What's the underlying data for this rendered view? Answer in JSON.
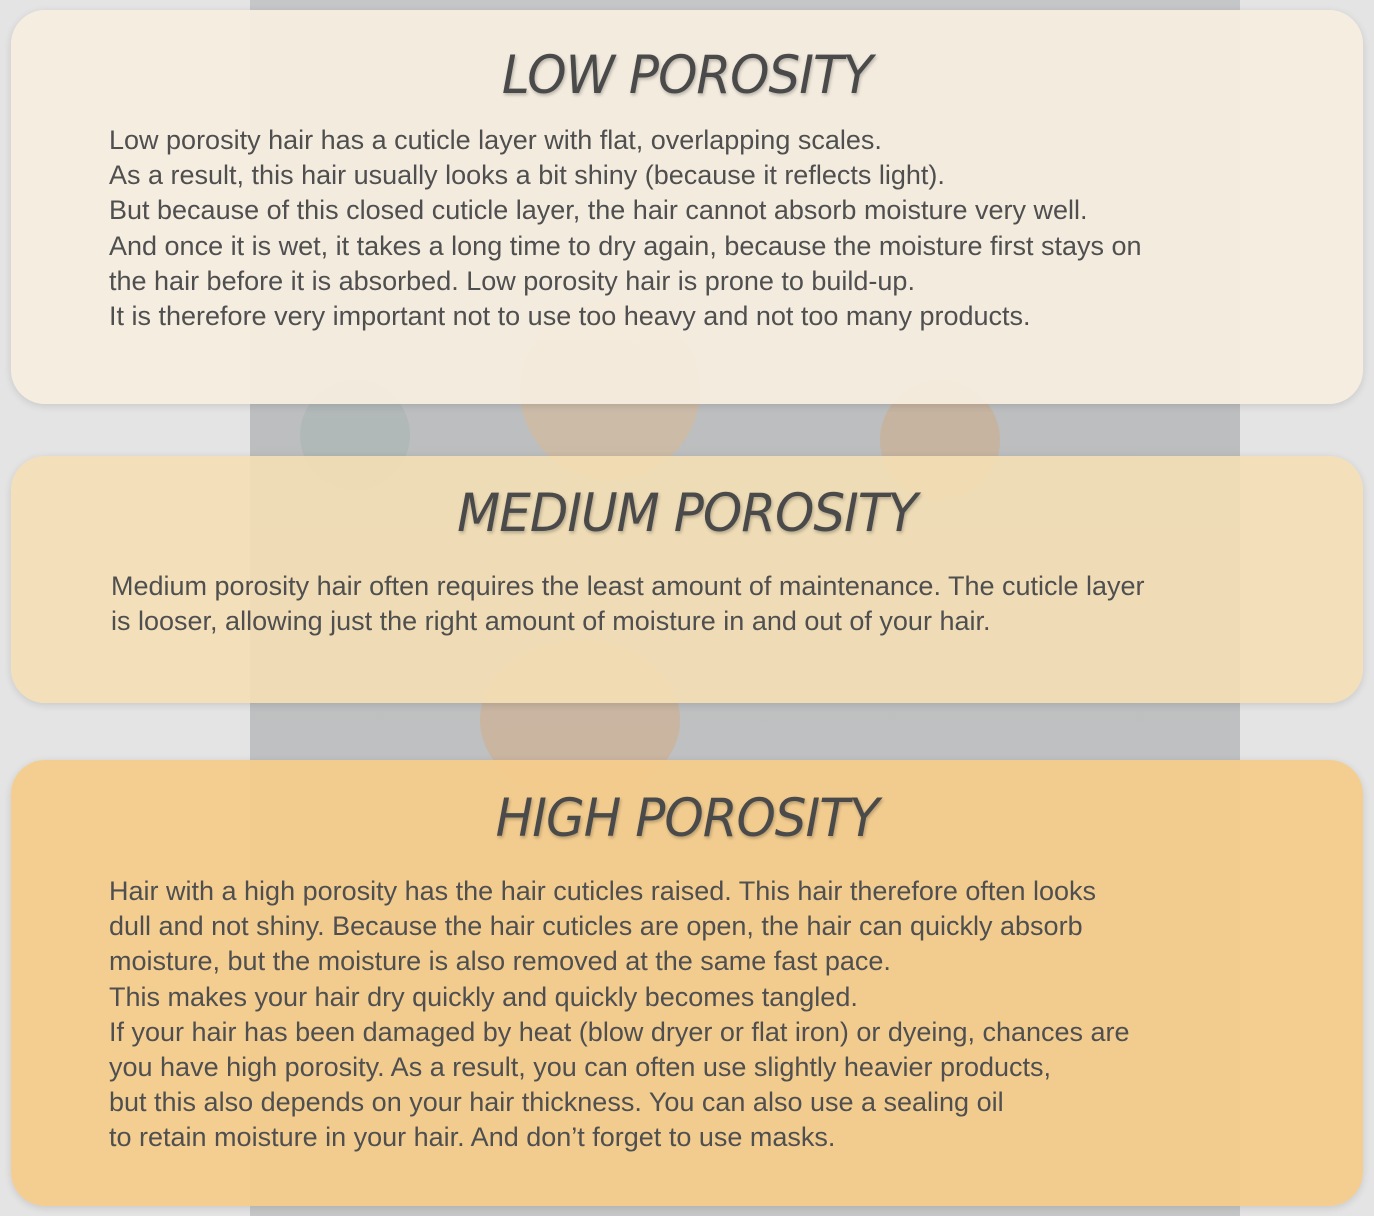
{
  "sections": {
    "low": {
      "title": "LOW POROSITY",
      "body": "Low porosity hair has a cuticle layer with flat, overlapping scales.\nAs a result, this hair usually looks a bit shiny (because it reflects light).\nBut because of this closed cuticle layer, the hair cannot absorb moisture very well.\nAnd once it is wet, it takes a long time to dry again, because the moisture first stays on\nthe hair before it is absorbed. Low porosity hair is prone to build-up.\nIt is therefore very important not to use too heavy and not too many products."
    },
    "medium": {
      "title": "MEDIUM POROSITY",
      "body": "Medium porosity hair often requires the least amount of maintenance. The cuticle layer\nis looser, allowing just the right amount of moisture in and out of your hair."
    },
    "high": {
      "title": "HIGH POROSITY",
      "body": "Hair with a high porosity has the hair cuticles raised. This hair therefore often looks\ndull and not shiny. Because the hair cuticles are open, the hair can quickly absorb\nmoisture, but the moisture is also removed at the same fast pace.\nThis makes your hair dry quickly and quickly becomes tangled.\nIf your hair has been damaged by heat (blow dryer or flat iron) or dyeing, chances are\nyou have high porosity. As a result, you can often use slightly heavier products,\nbut this also depends on your hair thickness. You can also use a sealing oil\nto retain moisture in your hair. And don’t forget to use masks."
    }
  },
  "colors": {
    "low_card": "#f6eee0",
    "medium_card": "#f4dfb5",
    "high_card": "#f4cc8c",
    "text": "#4f4f4f"
  }
}
